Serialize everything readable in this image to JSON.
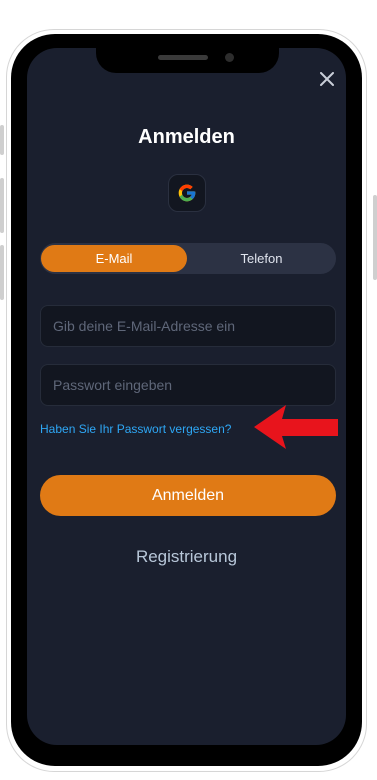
{
  "modal": {
    "title": "Anmelden",
    "close_icon": "close-icon",
    "google_icon": "google-icon"
  },
  "tabs": {
    "email_label": "E-Mail",
    "phone_label": "Telefon",
    "active": "E-Mail"
  },
  "form": {
    "email_placeholder": "Gib deine E-Mail-Adresse ein",
    "password_placeholder": "Passwort eingeben",
    "forgot_password": "Haben Sie Ihr Passwort vergessen?",
    "submit_label": "Anmelden",
    "register_label": "Registrierung"
  },
  "colors": {
    "accent": "#e07a15",
    "background": "#1a1f2e",
    "link": "#2ea7f5",
    "annotation_arrow": "#e8141c"
  }
}
